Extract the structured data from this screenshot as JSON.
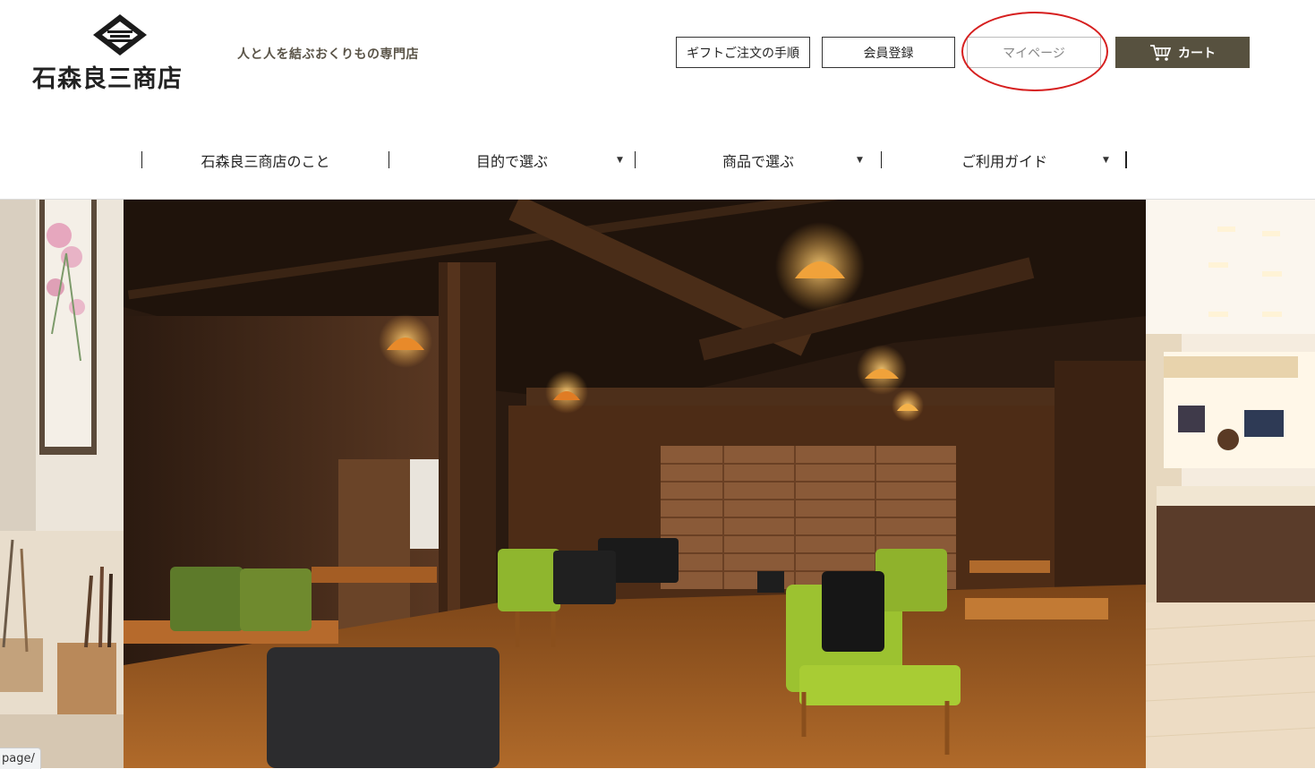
{
  "header": {
    "logo_text": "石森良三商店",
    "tagline": "人と人を結ぶおくりもの専門店",
    "buttons": {
      "gift_order": "ギフトご注文の手順",
      "register": "会員登録",
      "mypage": "マイページ",
      "cart": "カート"
    }
  },
  "nav": {
    "items": [
      {
        "label": "石森良三商店のこと",
        "has_dropdown": false
      },
      {
        "label": "目的で選ぶ",
        "has_dropdown": true
      },
      {
        "label": "商品で選ぶ",
        "has_dropdown": true
      },
      {
        "label": "ご利用ガイド",
        "has_dropdown": true
      }
    ],
    "caret": "▼"
  },
  "status_url": "page/",
  "colors": {
    "cart_bg": "#57513f",
    "annotation": "#d61f1f",
    "tagline": "#5a5448"
  },
  "icons": {
    "logo": "diamond-crest-icon",
    "cart": "shopping-cart-icon",
    "dropdown": "caret-down-icon"
  }
}
